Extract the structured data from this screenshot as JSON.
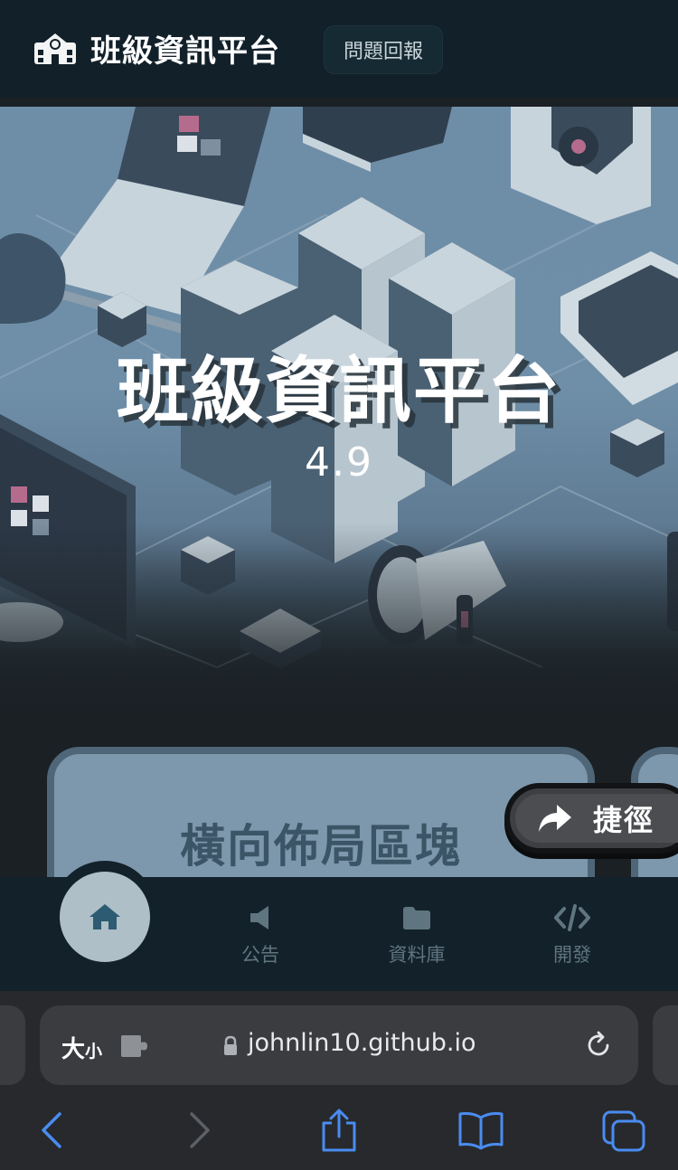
{
  "header": {
    "brand_icon": "school-icon",
    "brand_title": "班級資訊平台",
    "report_button": "問題回報"
  },
  "hero": {
    "title": "班級資訊平台",
    "version": "4.9"
  },
  "cards": {
    "main_title": "橫向佈局區塊"
  },
  "shortcut": {
    "icon": "share-arrow-icon",
    "label": "捷徑"
  },
  "bottom_nav": {
    "items": [
      {
        "icon": "home-icon",
        "label": "",
        "active": true
      },
      {
        "icon": "megaphone-icon",
        "label": "公告"
      },
      {
        "icon": "folder-icon",
        "label": "資料庫"
      },
      {
        "icon": "code-icon",
        "label": "開發"
      }
    ]
  },
  "browser": {
    "text_size_big": "大",
    "text_size_small": "小",
    "url": "johnlin10.github.io",
    "accent": "#4a8cf0"
  }
}
